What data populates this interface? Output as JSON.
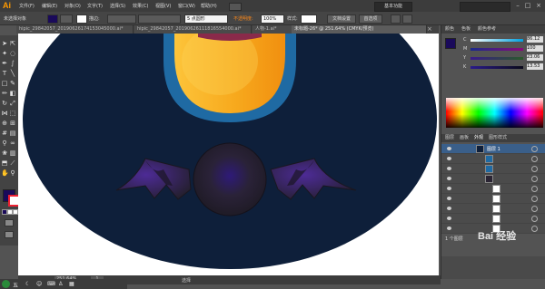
{
  "app": {
    "logo": "Ai"
  },
  "menu": {
    "items": [
      "文件(F)",
      "编辑(E)",
      "对象(O)",
      "文字(T)",
      "选择(S)",
      "效果(C)",
      "视图(V)",
      "窗口(W)",
      "帮助(H)"
    ]
  },
  "workspace": {
    "label": "基本功能"
  },
  "control_bar": {
    "selection_label": "未选择对象",
    "fill_color": "#1a0a5a",
    "stroke_label": "描边:",
    "point_label": "5 点圆形",
    "opacity_label": "不透明度:",
    "opacity_value": "100%",
    "style_label": "样式:",
    "doc_setup_button": "文档设置",
    "prefs_button": "首选项"
  },
  "tabs": [
    {
      "label": "hipic_29842057_20190626174153045000.ai*"
    },
    {
      "label": "hipic_29842057_20190626111816554000.ai*"
    },
    {
      "label": "人物-1.ai*"
    },
    {
      "label": "未标题-26* @ 251.64% (CMYK/预览)",
      "active": true
    }
  ],
  "right_panel": {
    "color_tabs": [
      "颜色",
      "色板",
      "颜色参考"
    ],
    "sliders": [
      {
        "label": "C",
        "value": "86.12"
      },
      {
        "label": "M",
        "value": "100"
      },
      {
        "label": "Y",
        "value": "23.06"
      },
      {
        "label": "K",
        "value": "13.53"
      }
    ],
    "layer_tabs": [
      "图层",
      "画板",
      "外观",
      "图形样式"
    ],
    "layer_name": "图层 1",
    "layer_count": "1 个图层"
  },
  "status": {
    "zoom": "251.64%",
    "page": "1",
    "tool": "选择"
  },
  "taskbar": {
    "ime": "五"
  },
  "watermark": "Bai 经验",
  "colors": {
    "navy": "#0e1f3a",
    "blue_ring": "#1f6aa3",
    "orange": "#f5a41c",
    "orange_light": "#fcc94a",
    "bat_body": "#2a2433",
    "bat_wing_glow": "#4a2a8a",
    "mouth": "#8a2a4a"
  }
}
